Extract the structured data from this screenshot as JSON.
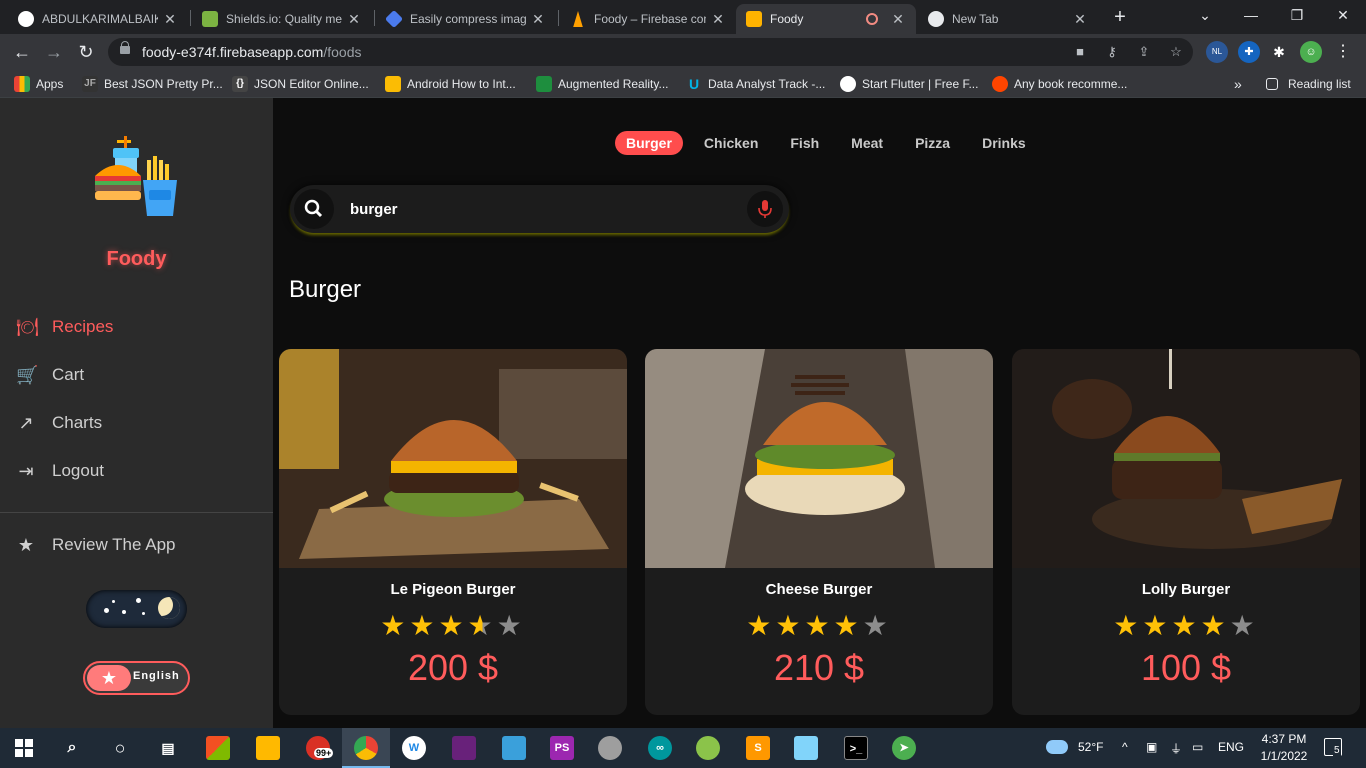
{
  "browser": {
    "tabs": [
      {
        "label": "ABDULKARIMALBAIK/",
        "color": "#ffffff"
      },
      {
        "label": "Shields.io: Quality met",
        "color": "#7cb342"
      },
      {
        "label": "Easily compress image",
        "color": "#4b7bec"
      },
      {
        "label": "Foody – Firebase cons",
        "color": "#ffa000"
      },
      {
        "label": "Foody",
        "color": "#ffb300"
      },
      {
        "label": "New Tab",
        "color": "#e8eaed"
      }
    ],
    "url_host": "foody-e374f.firebaseapp.com",
    "url_path": "/foods",
    "bookmarks": [
      {
        "label": "Apps",
        "color": "#ea4335"
      },
      {
        "label": "Best JSON Pretty Pr...",
        "color": "#333333",
        "icon_text": "JF"
      },
      {
        "label": "JSON Editor Online...",
        "color": "#444444",
        "icon_text": "{}"
      },
      {
        "label": "Android How to Int...",
        "color": "#fbbc04"
      },
      {
        "label": "Augmented Reality...",
        "color": "#1e8e3e"
      },
      {
        "label": "Data Analyst Track -...",
        "color": "#02b3e4",
        "icon_text": "U"
      },
      {
        "label": "Start Flutter | Free F...",
        "color": "#ffffff"
      },
      {
        "label": "Any book recomme...",
        "color": "#ff4500"
      }
    ],
    "reading_list": "Reading list",
    "extension_badge": "NL"
  },
  "app": {
    "brand": "Foody",
    "nav": [
      {
        "label": "Recipes",
        "icon": "food-icon",
        "active": true
      },
      {
        "label": "Cart",
        "icon": "cart-icon",
        "active": false
      },
      {
        "label": "Charts",
        "icon": "trend-icon",
        "active": false
      },
      {
        "label": "Logout",
        "icon": "logout-icon",
        "active": false
      }
    ],
    "review_label": "Review The App",
    "language_label": "English",
    "categories": [
      {
        "label": "Burger",
        "active": true
      },
      {
        "label": "Chicken",
        "active": false
      },
      {
        "label": "Fish",
        "active": false
      },
      {
        "label": "Meat",
        "active": false
      },
      {
        "label": "Pizza",
        "active": false
      },
      {
        "label": "Drinks",
        "active": false
      }
    ],
    "search": {
      "value": "burger"
    },
    "section_title": "Burger",
    "foods": [
      {
        "name": "Le Pigeon Burger",
        "rating": 3.5,
        "price": "200 $"
      },
      {
        "name": "Cheese Burger",
        "rating": 4,
        "price": "210 $"
      },
      {
        "name": "Lolly Burger",
        "rating": 4,
        "price": "100 $"
      }
    ]
  },
  "taskbar": {
    "weather": "52°F",
    "language": "ENG",
    "time": "4:37 PM",
    "date": "1/1/2022",
    "notifications": "5",
    "mail_badge": "99+"
  }
}
